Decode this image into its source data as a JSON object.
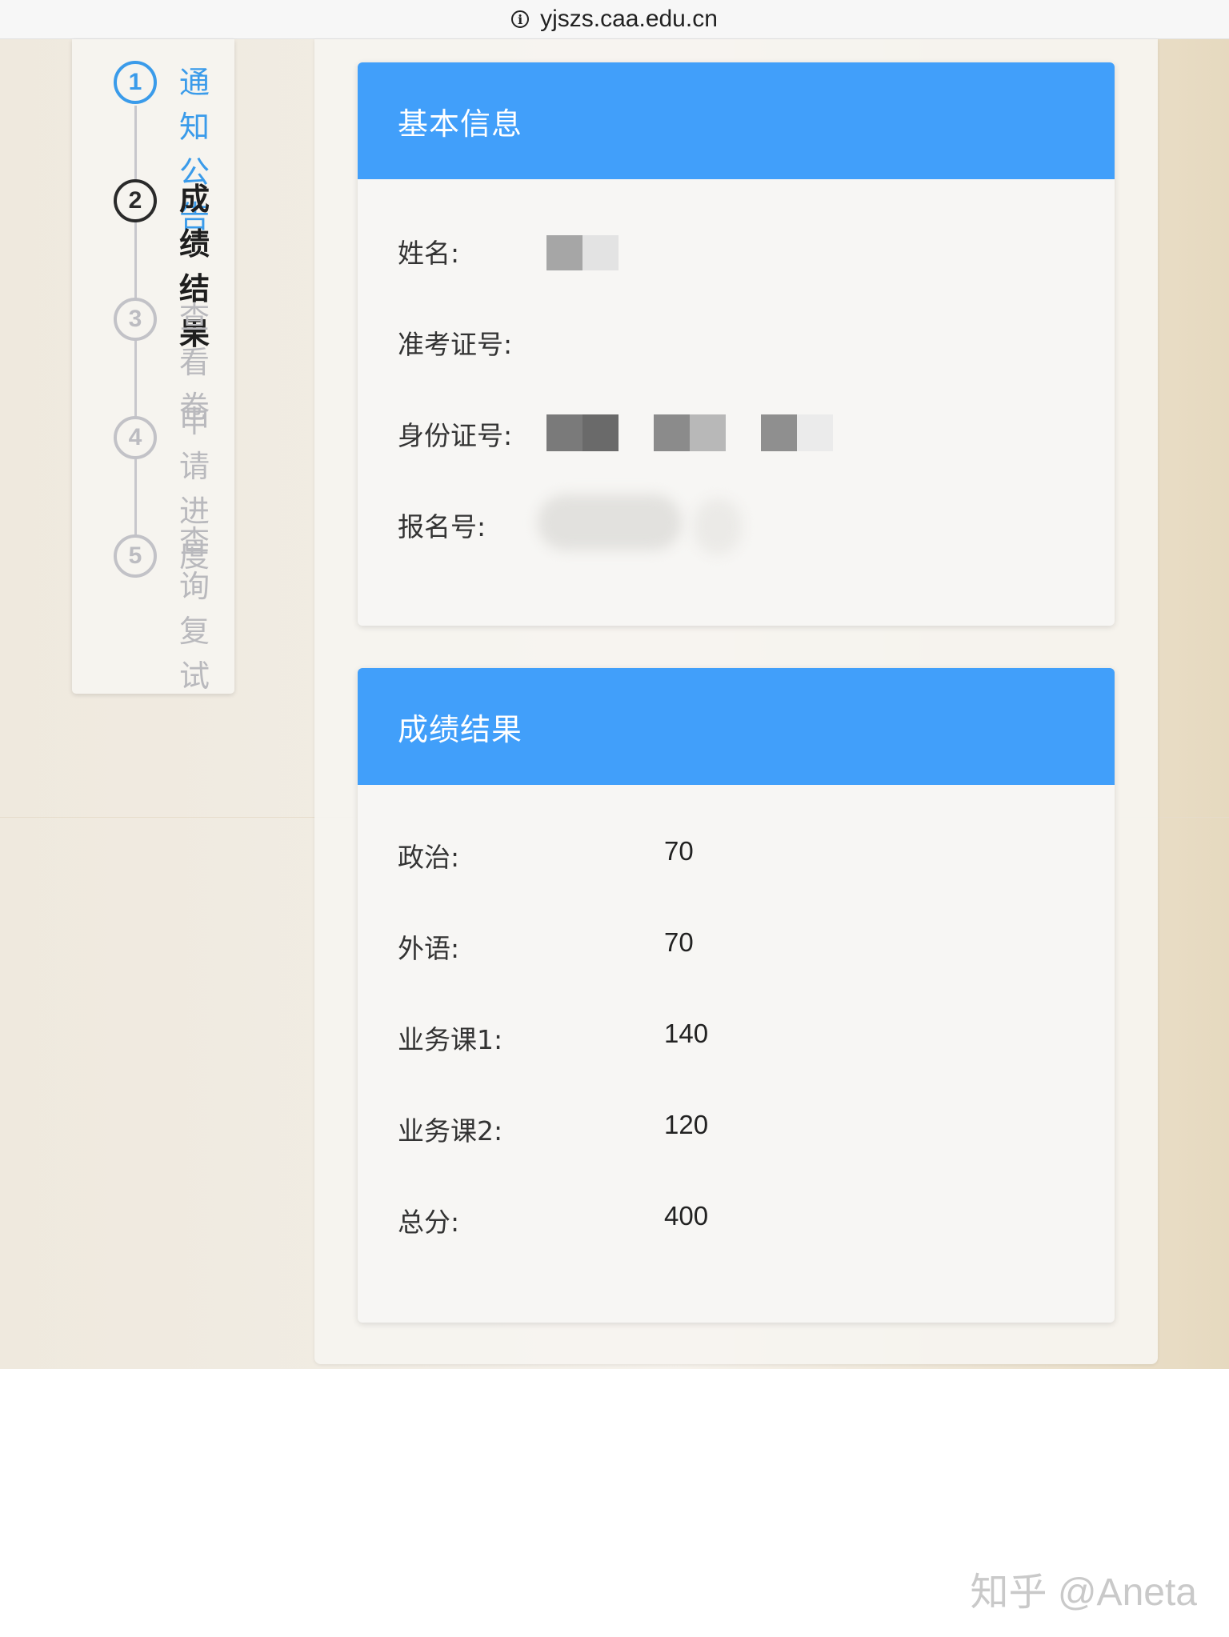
{
  "browser": {
    "url": "yjszs.caa.edu.cn"
  },
  "steps": [
    {
      "number": "1",
      "label": "通知公告",
      "state": "active"
    },
    {
      "number": "2",
      "label": "成绩结果",
      "state": "current"
    },
    {
      "number": "3",
      "label": "查看卷",
      "state": "muted"
    },
    {
      "number": "4",
      "label": "申请进度",
      "state": "muted"
    },
    {
      "number": "5",
      "label": "查询复试成绩",
      "state": "muted"
    }
  ],
  "basic_info": {
    "title": "基本信息",
    "name_label": "姓名:",
    "exam_no_label": "准考证号:",
    "id_no_label": "身份证号:",
    "reg_no_label": "报名号:"
  },
  "scores": {
    "title": "成绩结果",
    "rows": [
      {
        "label": "政治:",
        "value": "70"
      },
      {
        "label": "外语:",
        "value": "70"
      },
      {
        "label": "业务课1:",
        "value": "140"
      },
      {
        "label": "业务课2:",
        "value": "120"
      },
      {
        "label": "总分:",
        "value": "400"
      }
    ]
  },
  "watermark": "知乎 @Aneta",
  "colors": {
    "header_blue": "#419ffa",
    "step_active": "#3a9bea"
  }
}
